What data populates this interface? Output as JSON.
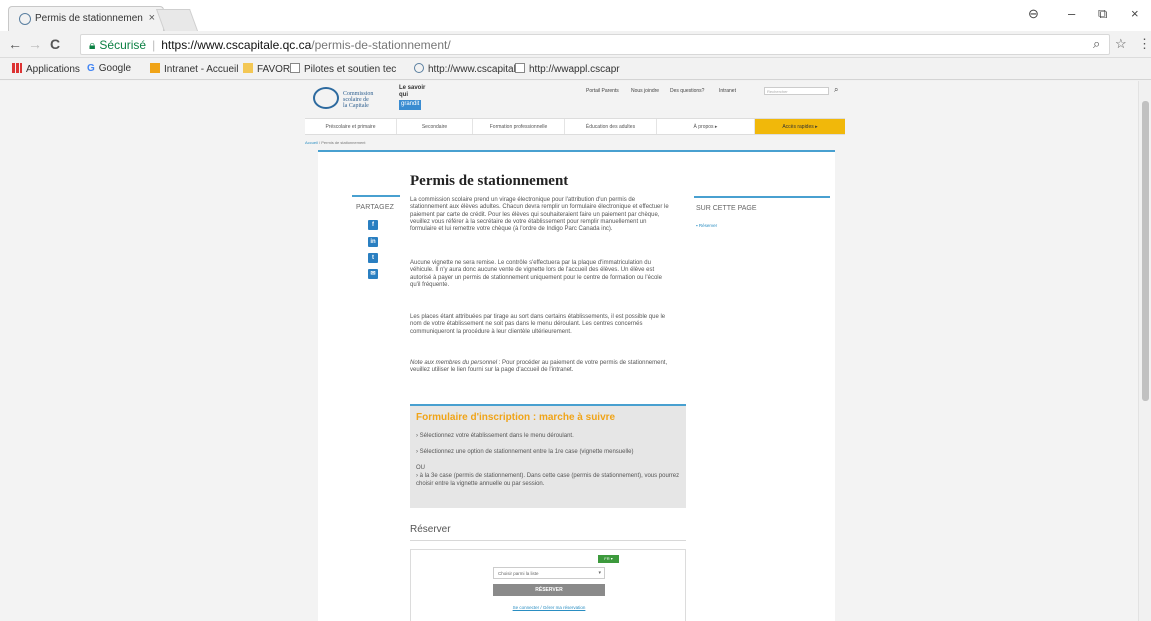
{
  "browser": {
    "tab_title": "Permis de stationnemen",
    "tab_close": "×",
    "window_controls": {
      "account": "⊖",
      "minimize": "–",
      "maximize": "⧉",
      "close": "×"
    },
    "nav": {
      "back": "←",
      "forward": "→",
      "reload": "C"
    },
    "security_label": "Sécurisé",
    "url_host": "https://www.cscapitale.qc.ca",
    "url_path": "/permis-de-stationnement/",
    "zoom_icon": "⌕",
    "star_icon": "☆",
    "menu_icon": "⋮"
  },
  "bookmarks": [
    "Applications",
    "Google",
    "Intranet - Accueil",
    "FAVORIS",
    "Pilotes et soutien tec",
    "http://www.cscapitale",
    "http://wwappl.cscapr"
  ],
  "site": {
    "logo_text": [
      "Commission",
      "scolaire de",
      "la Capitale"
    ],
    "savoir_text": [
      "Le savoir",
      "qui"
    ],
    "savoir_badge": "grandit",
    "top_links": [
      "Portail Parents",
      "Nous joindre",
      "Des questions?",
      "Intranet"
    ],
    "search_placeholder": "Rechercher",
    "search_icon": "⌕",
    "main_nav": [
      "Préscolaire et primaire",
      "Secondaire",
      "Formation professionnelle",
      "Éducation des adultes",
      "À propos ▸",
      "Accès rapides ▸"
    ],
    "breadcrumb_home": "Accueil",
    "breadcrumb_current": "/ Permis de stationnement"
  },
  "page": {
    "title": "Permis de stationnement",
    "share_label": "PARTAGEZ",
    "share_icons": [
      "f",
      "in",
      "t",
      "✉"
    ],
    "paragraphs": [
      "La commission scolaire prend un virage électronique pour l'attribution d'un permis de stationnement aux élèves adultes. Chacun devra remplir un formulaire électronique et effectuer le paiement par carte de crédit. Pour les élèves qui souhaiteraient faire un paiement par chèque, veuillez vous référer à la secrétaire de votre établissement pour remplir manuellement un formulaire et lui remettre votre chèque (à l'ordre de Indigo Parc Canada inc).",
      "Aucune vignette ne sera remise. Le contrôle s'effectuera par la plaque d'immatriculation du véhicule. Il n'y aura donc aucune vente de vignette lors de l'accueil des élèves. Un élève est autorisé à payer un permis de stationnement uniquement pour le centre de formation ou l'école qu'il fréquente.",
      "Les places étant attribuées par tirage au sort dans certains établissements, il est possible que le nom de votre établissement ne soit pas dans le menu déroulant. Les centres concernés communiqueront la procédure à leur clientèle ultérieurement."
    ],
    "note_italic": "Note aux membres du personnel",
    "note_rest": " : Pour procéder au paiement de votre permis de stationnement, veuillez utiliser le lien fourni sur la page d'accueil de l'intranet.",
    "sidebar_title": "SUR CETTE PAGE",
    "sidebar_link": "▪ Réserver",
    "form_title": "Formulaire d'inscription : marche à suivre",
    "form_steps": [
      "› Sélectionnez votre établissement dans le menu déroulant.",
      "› Sélectionnez une option de stationnement entre la 1re case (vignette mensuelle)",
      "OU",
      "› à la 3e case (permis de stationnement). Dans cette case (permis de stationnement), vous pourrez choisir entre la vignette annuelle ou par session."
    ],
    "reserver_heading": "Réserver",
    "widget": {
      "lang": "FR ▾",
      "select_value": "Choisir parmi la liste",
      "select_caret": "▾",
      "button": "RÉSERVER",
      "link": "Se connecter / Gérer ma réservation"
    }
  }
}
